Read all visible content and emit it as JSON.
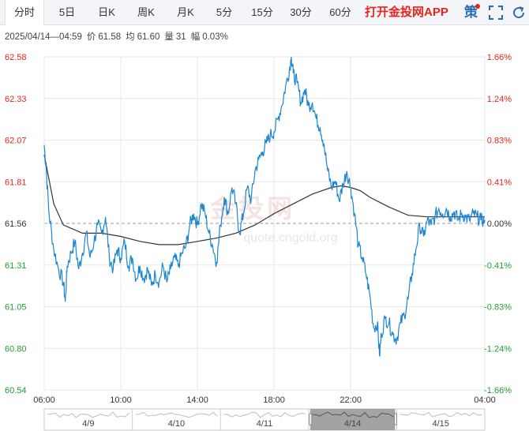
{
  "tabs": [
    {
      "label": "分时",
      "active": true
    },
    {
      "label": "5日",
      "active": false
    },
    {
      "label": "日K",
      "active": false
    },
    {
      "label": "周K",
      "active": false
    },
    {
      "label": "月K",
      "active": false
    },
    {
      "label": "5分",
      "active": false
    },
    {
      "label": "15分",
      "active": false
    },
    {
      "label": "30分",
      "active": false
    },
    {
      "label": "60分",
      "active": false
    }
  ],
  "promo_label": "打开金投网APP",
  "strategy_label": "策",
  "info": {
    "datetime": "2025/04/14—04:59",
    "price_label": "价",
    "price": "61.58",
    "avg_label": "均",
    "avg": "61.60",
    "vol_label": "量",
    "vol": "31",
    "chg_label": "幅",
    "chg": "0.03%"
  },
  "watermark": {
    "main": "金投网",
    "sub": "quote.cngold.org"
  },
  "colors": {
    "price_line": "#1c86d1",
    "avg_line": "#333333",
    "up": "#e8241c",
    "down": "#1f9e35",
    "neutral": "#333333",
    "grid": "#e7e7e7",
    "ref_line": "#999999"
  },
  "chart_data": {
    "type": "line",
    "title": "",
    "reference_price": 61.56,
    "ylim": [
      60.54,
      62.58
    ],
    "left_ticks": [
      "62.58",
      "62.33",
      "62.07",
      "61.81",
      "61.56",
      "61.31",
      "61.05",
      "60.80",
      "60.54"
    ],
    "right_ticks": [
      "1.66%",
      "1.24%",
      "0.83%",
      "0.41%",
      "0.00%",
      "-0.41%",
      "-0.83%",
      "-1.24%",
      "-1.66%"
    ],
    "x_ticks": [
      "06:00",
      "10:00",
      "14:00",
      "18:00",
      "22:00",
      "04:00"
    ],
    "x_range_hours": [
      0,
      23
    ],
    "series": [
      {
        "name": "价",
        "points": [
          [
            0.0,
            62.04
          ],
          [
            0.1,
            61.9
          ],
          [
            0.25,
            61.62
          ],
          [
            0.5,
            61.4
          ],
          [
            0.75,
            61.28
          ],
          [
            1.0,
            61.2
          ],
          [
            1.1,
            61.08
          ],
          [
            1.2,
            61.3
          ],
          [
            1.4,
            61.38
          ],
          [
            1.6,
            61.45
          ],
          [
            1.8,
            61.28
          ],
          [
            2.0,
            61.38
          ],
          [
            2.2,
            61.5
          ],
          [
            2.4,
            61.35
          ],
          [
            2.6,
            61.45
          ],
          [
            2.8,
            61.55
          ],
          [
            3.0,
            61.5
          ],
          [
            3.2,
            61.6
          ],
          [
            3.4,
            61.35
          ],
          [
            3.6,
            61.28
          ],
          [
            3.8,
            61.4
          ],
          [
            4.0,
            61.35
          ],
          [
            4.2,
            61.45
          ],
          [
            4.4,
            61.3
          ],
          [
            4.6,
            61.35
          ],
          [
            4.8,
            61.22
          ],
          [
            5.0,
            61.3
          ],
          [
            5.2,
            61.22
          ],
          [
            5.4,
            61.28
          ],
          [
            5.6,
            61.18
          ],
          [
            5.8,
            61.25
          ],
          [
            6.0,
            61.2
          ],
          [
            6.2,
            61.3
          ],
          [
            6.4,
            61.2
          ],
          [
            6.6,
            61.28
          ],
          [
            6.8,
            61.35
          ],
          [
            7.0,
            61.3
          ],
          [
            7.2,
            61.38
          ],
          [
            7.4,
            61.42
          ],
          [
            7.6,
            61.55
          ],
          [
            7.8,
            61.62
          ],
          [
            8.0,
            61.55
          ],
          [
            8.2,
            61.68
          ],
          [
            8.4,
            61.62
          ],
          [
            8.6,
            61.5
          ],
          [
            8.8,
            61.42
          ],
          [
            9.0,
            61.32
          ],
          [
            9.2,
            61.55
          ],
          [
            9.4,
            61.72
          ],
          [
            9.6,
            61.62
          ],
          [
            9.8,
            61.78
          ],
          [
            10.0,
            61.68
          ],
          [
            10.2,
            61.5
          ],
          [
            10.4,
            61.62
          ],
          [
            10.6,
            61.78
          ],
          [
            10.8,
            61.7
          ],
          [
            11.0,
            61.88
          ],
          [
            11.2,
            61.95
          ],
          [
            11.4,
            62.0
          ],
          [
            11.6,
            62.05
          ],
          [
            11.8,
            62.1
          ],
          [
            12.0,
            62.12
          ],
          [
            12.2,
            62.2
          ],
          [
            12.4,
            62.28
          ],
          [
            12.6,
            62.4
          ],
          [
            12.8,
            62.5
          ],
          [
            12.9,
            62.58
          ],
          [
            13.0,
            62.48
          ],
          [
            13.2,
            62.42
          ],
          [
            13.4,
            62.3
          ],
          [
            13.6,
            62.38
          ],
          [
            13.8,
            62.28
          ],
          [
            14.0,
            62.3
          ],
          [
            14.2,
            62.2
          ],
          [
            14.4,
            62.15
          ],
          [
            14.6,
            62.05
          ],
          [
            14.8,
            61.88
          ],
          [
            15.0,
            61.78
          ],
          [
            15.2,
            61.82
          ],
          [
            15.4,
            61.7
          ],
          [
            15.6,
            61.8
          ],
          [
            15.8,
            61.88
          ],
          [
            16.0,
            61.78
          ],
          [
            16.2,
            61.62
          ],
          [
            16.4,
            61.42
          ],
          [
            16.6,
            61.35
          ],
          [
            16.8,
            61.25
          ],
          [
            17.0,
            61.12
          ],
          [
            17.2,
            60.92
          ],
          [
            17.4,
            60.95
          ],
          [
            17.5,
            60.75
          ],
          [
            17.6,
            60.88
          ],
          [
            17.8,
            60.98
          ],
          [
            18.0,
            60.95
          ],
          [
            18.2,
            60.88
          ],
          [
            18.4,
            60.85
          ],
          [
            18.6,
            60.95
          ],
          [
            18.8,
            61.0
          ],
          [
            19.0,
            61.1
          ],
          [
            19.2,
            61.25
          ],
          [
            19.4,
            61.4
          ],
          [
            19.6,
            61.55
          ],
          [
            19.8,
            61.48
          ],
          [
            20.0,
            61.58
          ],
          [
            20.2,
            61.55
          ],
          [
            20.4,
            61.6
          ],
          [
            20.6,
            61.65
          ],
          [
            20.8,
            61.62
          ],
          [
            21.0,
            61.65
          ],
          [
            21.2,
            61.6
          ],
          [
            21.4,
            61.63
          ],
          [
            21.6,
            61.58
          ],
          [
            21.8,
            61.62
          ],
          [
            22.0,
            61.6
          ],
          [
            22.2,
            61.58
          ],
          [
            22.4,
            61.62
          ],
          [
            22.6,
            61.6
          ],
          [
            22.8,
            61.58
          ],
          [
            23.0,
            61.58
          ]
        ]
      },
      {
        "name": "均",
        "points": [
          [
            0.0,
            61.98
          ],
          [
            0.5,
            61.68
          ],
          [
            1.0,
            61.55
          ],
          [
            2.0,
            61.5
          ],
          [
            3.0,
            61.5
          ],
          [
            4.0,
            61.48
          ],
          [
            5.0,
            61.45
          ],
          [
            6.0,
            61.43
          ],
          [
            7.0,
            61.43
          ],
          [
            8.0,
            61.45
          ],
          [
            9.0,
            61.47
          ],
          [
            10.0,
            61.5
          ],
          [
            11.0,
            61.55
          ],
          [
            12.0,
            61.62
          ],
          [
            13.0,
            61.68
          ],
          [
            14.0,
            61.74
          ],
          [
            14.5,
            61.76
          ],
          [
            15.0,
            61.78
          ],
          [
            15.5,
            61.79
          ],
          [
            16.0,
            61.78
          ],
          [
            16.5,
            61.76
          ],
          [
            17.0,
            61.72
          ],
          [
            18.0,
            61.66
          ],
          [
            19.0,
            61.61
          ],
          [
            20.0,
            61.6
          ],
          [
            21.0,
            61.6
          ],
          [
            22.0,
            61.6
          ],
          [
            23.0,
            61.6
          ]
        ]
      }
    ],
    "navigator": {
      "labels": [
        "4/9",
        "4/10",
        "4/11",
        "4/14",
        "4/15"
      ],
      "selected": "4/14"
    }
  }
}
